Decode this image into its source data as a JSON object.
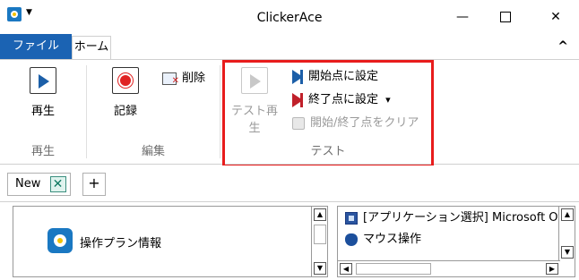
{
  "window": {
    "title": "ClickerAce",
    "min_glyph": "—",
    "close_glyph": "✕"
  },
  "tabs": {
    "file": "ファイル",
    "home": "ホーム",
    "collapse_glyph": "^"
  },
  "ribbon": {
    "play_group": {
      "play_label": "再生",
      "group_label": "再生"
    },
    "edit_group": {
      "record_label": "記録",
      "delete_label": "削除",
      "group_label": "編集"
    },
    "test_group": {
      "test_play_label": "テスト再生",
      "set_start_label": "開始点に設定",
      "set_end_label": "終了点に設定",
      "set_end_dropdown": "▾",
      "clear_label": "開始/終了点をクリア",
      "group_label": "テスト"
    },
    "highlight_color": "#e81c1c"
  },
  "doc_tabs": {
    "new_tab_label": "New",
    "new_tab_close": "✕",
    "add_tab": "+"
  },
  "left_panel": {
    "item_label": "操作プラン情報",
    "scroll_up": "▲",
    "scroll_down": "▼"
  },
  "right_panel": {
    "items": [
      {
        "label": "[アプリケーション選択] Microsoft Of",
        "icon": "app-select-icon"
      },
      {
        "label": "マウス操作",
        "icon": "mouse-icon"
      }
    ],
    "scroll_up": "▲",
    "scroll_down": "▼",
    "scroll_left": "◀",
    "scroll_right": "▶"
  },
  "colors": {
    "file_tab": "#1b63b3",
    "brand_blue": "#1a78c2",
    "record_red": "#e02222"
  }
}
